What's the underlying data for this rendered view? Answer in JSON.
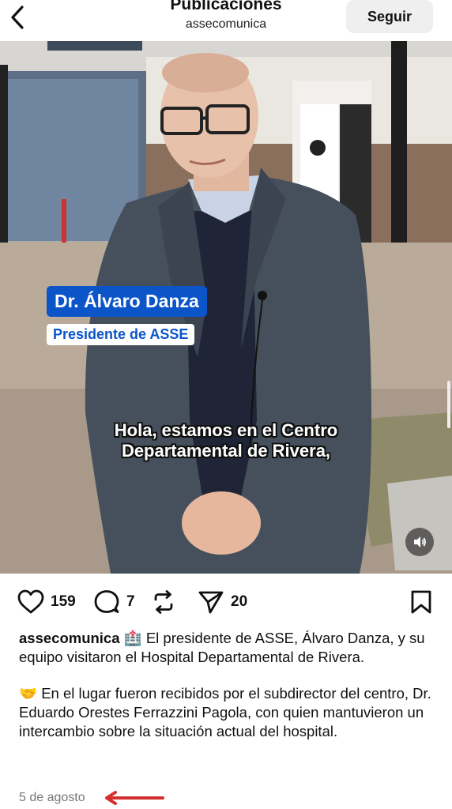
{
  "header": {
    "title": "Publicaciones",
    "account": "assecomunica",
    "follow_label": "Seguir"
  },
  "video": {
    "name_label": "Dr. Álvaro Danza",
    "role_label": "Presidente de ASSE",
    "subtitle_line1": "Hola, estamos en el Centro",
    "subtitle_line2": "Departamental de Rivera,"
  },
  "actions": {
    "likes": "159",
    "comments": "7",
    "shares": "20"
  },
  "post": {
    "username": "assecomunica",
    "emoji1": "🏥",
    "text1": "El presidente de ASSE, Álvaro Danza, y su equipo visitaron el Hospital Departamental de Rivera.",
    "emoji2": "🤝",
    "text2": "En el lugar fueron recibidos por el subdirector del centro, Dr. Eduardo Orestes Ferrazzini Pagola, con quien mantuvieron un intercambio sobre la situación actual del hospital.",
    "date": "5 de agosto"
  },
  "colors": {
    "badge_blue": "#0b55c9",
    "annotation_arrow": "#d32f2f"
  }
}
